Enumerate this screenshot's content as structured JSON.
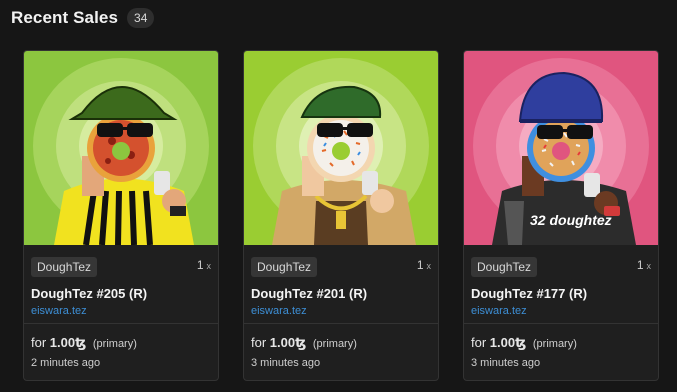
{
  "section": {
    "title": "Recent Sales",
    "count": "34"
  },
  "cards": [
    {
      "collection": "DoughTez",
      "qty": "1",
      "qty_unit": "x",
      "title": "DoughTez #205 (R)",
      "creator": "eiswara.tez",
      "price_prefix": "for",
      "price": "1.00",
      "currency": "ꜩ",
      "sale_type": "(primary)",
      "time": "2 minutes ago",
      "bg": "#8cc63f",
      "accent": "#f2e022",
      "art": {
        "hat": "bucket-hat-green",
        "shirt": "yellow-striped-jersey",
        "donut": "pizza-donut"
      }
    },
    {
      "collection": "DoughTez",
      "qty": "1",
      "qty_unit": "x",
      "title": "DoughTez #201 (R)",
      "creator": "eiswara.tez",
      "price_prefix": "for",
      "price": "1.00",
      "currency": "ꜩ",
      "sale_type": "(primary)",
      "time": "3 minutes ago",
      "bg": "#9acd32",
      "accent": "#c9a36b",
      "art": {
        "hat": "green-cap",
        "shirt": "apron-gold-chain",
        "donut": "sprinkle-donut"
      }
    },
    {
      "collection": "DoughTez",
      "qty": "1",
      "qty_unit": "x",
      "title": "DoughTez #177 (R)",
      "creator": "eiswara.tez",
      "price_prefix": "for",
      "price": "1.00",
      "currency": "ꜩ",
      "sale_type": "(primary)",
      "time": "3 minutes ago",
      "bg": "#e0557f",
      "accent": "#3a3a3a",
      "art": {
        "hat": "blue-beanie",
        "shirt": "black-jersey-32",
        "donut": "blue-sprinkle-donut",
        "shirt_text": "32 doughtez"
      }
    }
  ]
}
